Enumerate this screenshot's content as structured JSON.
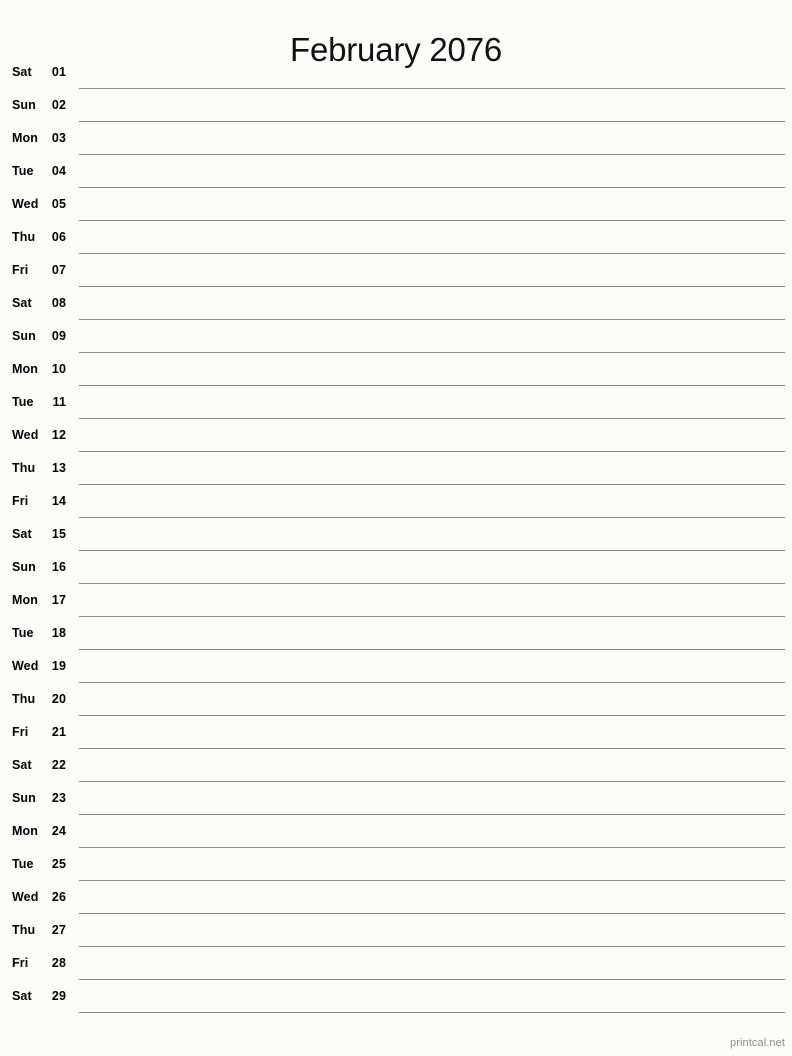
{
  "header": {
    "title": "February 2076"
  },
  "calendar": {
    "month_name": "February",
    "year": "2076",
    "days_in_month": 29,
    "rows": [
      {
        "dow": "Sat",
        "num": "01"
      },
      {
        "dow": "Sun",
        "num": "02"
      },
      {
        "dow": "Mon",
        "num": "03"
      },
      {
        "dow": "Tue",
        "num": "04"
      },
      {
        "dow": "Wed",
        "num": "05"
      },
      {
        "dow": "Thu",
        "num": "06"
      },
      {
        "dow": "Fri",
        "num": "07"
      },
      {
        "dow": "Sat",
        "num": "08"
      },
      {
        "dow": "Sun",
        "num": "09"
      },
      {
        "dow": "Mon",
        "num": "10"
      },
      {
        "dow": "Tue",
        "num": "11"
      },
      {
        "dow": "Wed",
        "num": "12"
      },
      {
        "dow": "Thu",
        "num": "13"
      },
      {
        "dow": "Fri",
        "num": "14"
      },
      {
        "dow": "Sat",
        "num": "15"
      },
      {
        "dow": "Sun",
        "num": "16"
      },
      {
        "dow": "Mon",
        "num": "17"
      },
      {
        "dow": "Tue",
        "num": "18"
      },
      {
        "dow": "Wed",
        "num": "19"
      },
      {
        "dow": "Thu",
        "num": "20"
      },
      {
        "dow": "Fri",
        "num": "21"
      },
      {
        "dow": "Sat",
        "num": "22"
      },
      {
        "dow": "Sun",
        "num": "23"
      },
      {
        "dow": "Mon",
        "num": "24"
      },
      {
        "dow": "Tue",
        "num": "25"
      },
      {
        "dow": "Wed",
        "num": "26"
      },
      {
        "dow": "Thu",
        "num": "27"
      },
      {
        "dow": "Fri",
        "num": "28"
      },
      {
        "dow": "Sat",
        "num": "29"
      }
    ]
  },
  "footer": {
    "credit": "printcal.net"
  },
  "colors": {
    "page_background": "#fcfdf8",
    "text": "#000000",
    "title": "#111111",
    "rule_line": "#8a8a8a",
    "footer_text": "#8d8d8d"
  }
}
